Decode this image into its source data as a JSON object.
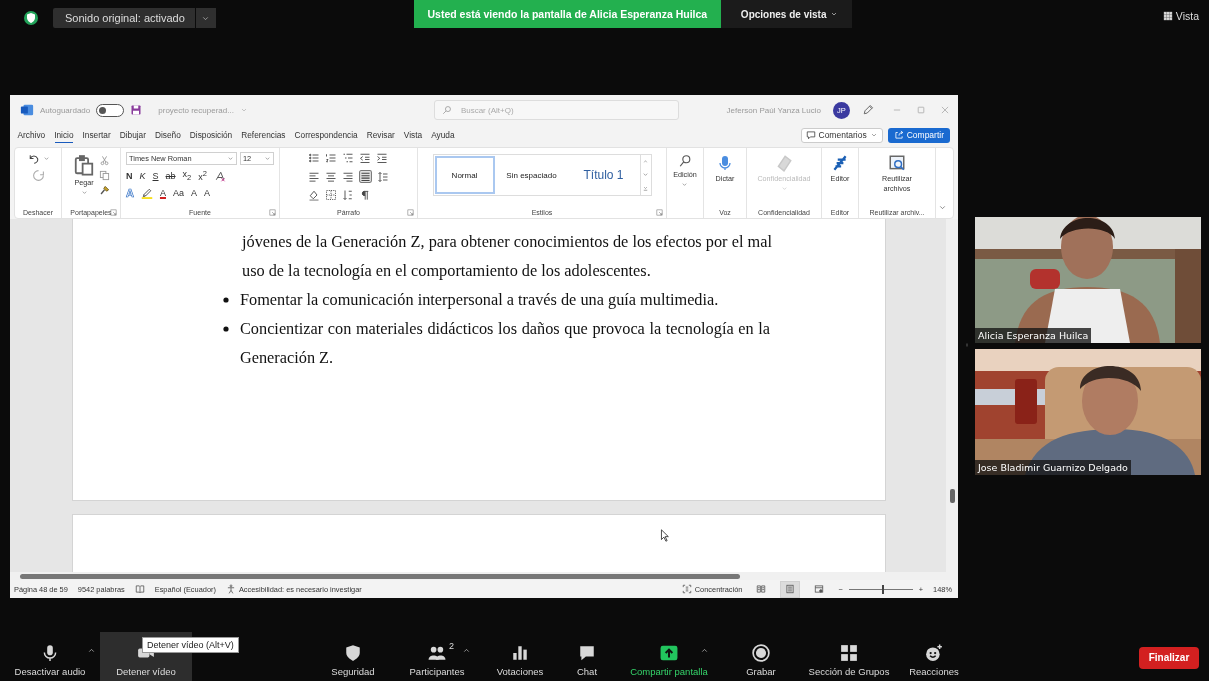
{
  "top_bar": {
    "audio_button": "Sonido original: activado",
    "sharing_banner": "Usted está viendo la pantalla de Alicia Esperanza Huilca",
    "view_options": "Opciones de vista",
    "view_button": "Vista"
  },
  "word": {
    "autosave": {
      "label": "Autoguardado",
      "on": false
    },
    "file_name": "proyecto recuperad...",
    "search": {
      "placeholder": "Buscar (Alt+Q)"
    },
    "user": {
      "name": "Jeferson Paúl Yanza Lucio",
      "initials": "JP"
    },
    "tabs": [
      {
        "label": "Archivo",
        "selected": false
      },
      {
        "label": "Inicio",
        "selected": true
      },
      {
        "label": "Insertar",
        "selected": false
      },
      {
        "label": "Dibujar",
        "selected": false
      },
      {
        "label": "Diseño",
        "selected": false
      },
      {
        "label": "Disposición",
        "selected": false
      },
      {
        "label": "Referencias",
        "selected": false
      },
      {
        "label": "Correspondencia",
        "selected": false
      },
      {
        "label": "Revisar",
        "selected": false
      },
      {
        "label": "Vista",
        "selected": false
      },
      {
        "label": "Ayuda",
        "selected": false
      }
    ],
    "comments_button": "Comentarios",
    "share_button": "Compartir",
    "ribbon_groups": [
      {
        "kind": "undo",
        "label": "Deshacer"
      },
      {
        "kind": "clipboard",
        "label": "Portapapeles",
        "button": "Pegar"
      },
      {
        "kind": "font",
        "label": "Fuente",
        "font_name": "Times New Roman",
        "font_size": "12",
        "keys": [
          {
            "kind": "bold",
            "text": "N"
          },
          {
            "kind": "italic",
            "text": "K"
          },
          {
            "kind": "underline",
            "text": "S"
          },
          {
            "kind": "strike",
            "text": "ab"
          },
          {
            "kind": "sub",
            "text": "x$_{2}$"
          },
          {
            "kind": "sup",
            "text": "x$^{2}$"
          }
        ],
        "row3": [
          {
            "kind": "effects",
            "text": "A"
          },
          {
            "kind": "highlight"
          },
          {
            "kind": "color",
            "text": "A"
          },
          {
            "kind": "case",
            "text": "Aa"
          },
          {
            "kind": "grow",
            "text": "A"
          },
          {
            "kind": "shrink",
            "text": "A"
          }
        ]
      },
      {
        "kind": "paragraph",
        "label": "Párrafo"
      },
      {
        "kind": "styles",
        "label": "Estilos",
        "styles": [
          {
            "label": "Normal",
            "selected": true
          },
          {
            "label": "Sin espaciado",
            "selected": false
          },
          {
            "label": "Título 1",
            "selected": false
          }
        ]
      },
      {
        "kind": "editing",
        "button": "Edición"
      },
      {
        "kind": "voice",
        "label": "Voz",
        "button": "Dictar"
      },
      {
        "kind": "sensitivity",
        "label": "Confidencialidad",
        "button": "Confidencialidad",
        "disabled": true
      },
      {
        "kind": "editor",
        "label": "Editor",
        "button": "Editor"
      },
      {
        "kind": "reuse",
        "label": "Reutilizar archiv...",
        "button": "Reutilizar archivos"
      }
    ],
    "document": {
      "paragraphs": [
        {
          "kind": "continuation",
          "text": "jóvenes de la Generación Z, para obtener conocimientos de los efectos por el mal uso de la tecnología en el comportamiento de los adolescentes."
        },
        {
          "kind": "bullet",
          "text": "Fomentar la comunicación interpersonal a través de una guía multimedia."
        },
        {
          "kind": "bullet",
          "text": "Concientizar con materiales didácticos los daños que provoca la tecnología en la Generación Z."
        }
      ]
    },
    "status_bar": {
      "page": "Página 48 de 59",
      "words": "9542 palabras",
      "language": "Español (Ecuador)",
      "accessibility": "Accesibilidad: es necesario investigar",
      "focus": "Concentración",
      "views": [
        {
          "kind": "read",
          "selected": false
        },
        {
          "kind": "print",
          "selected": true
        },
        {
          "kind": "web",
          "selected": false
        }
      ],
      "zoom_minus": "−",
      "zoom": {
        "level": 0.52
      },
      "zoom_plus": "+",
      "zoom_percent": "148%"
    }
  },
  "videos": [
    {
      "name": "Alicia Esperanza Huilca",
      "kind": "picture"
    },
    {
      "name": "Jose Bladimir Guarnizo Delgado",
      "kind": "picture"
    }
  ],
  "toolbar": {
    "items": [
      {
        "kind": "mic",
        "label": "Desactivar audio",
        "caret": true,
        "hovered": false
      },
      {
        "kind": "camera",
        "label": "Detener vídeo",
        "caret": false,
        "hovered": true
      },
      {
        "kind": "security",
        "label": "Seguridad",
        "caret": false,
        "hovered": false
      },
      {
        "kind": "participants",
        "label": "Participantes",
        "count": "2",
        "caret": true,
        "hovered": false
      },
      {
        "kind": "polls",
        "label": "Votaciones",
        "caret": false,
        "hovered": false
      },
      {
        "kind": "chat",
        "label": "Chat",
        "caret": false,
        "hovered": false
      },
      {
        "kind": "share",
        "label": "Compartir pantalla",
        "caret": true,
        "hovered": false
      },
      {
        "kind": "record",
        "label": "Grabar",
        "caret": false,
        "hovered": false
      },
      {
        "kind": "rooms",
        "label": "Sección de Grupos",
        "caret": false,
        "hovered": false
      },
      {
        "kind": "reactions",
        "label": "Reacciones",
        "caret": false,
        "hovered": false
      }
    ],
    "tooltip": "Detener vídeo (Alt+V)",
    "end_button": "Finalizar"
  }
}
